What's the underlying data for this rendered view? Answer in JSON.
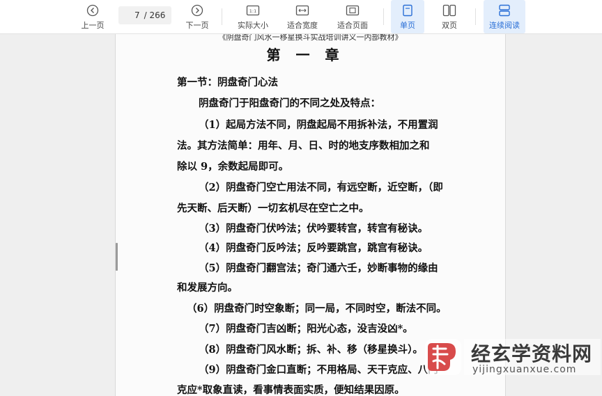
{
  "toolbar": {
    "prev_label": "上一页",
    "next_label": "下一页",
    "current_page": "7",
    "total_pages": "/ 266",
    "actual_size_label": "实际大小",
    "fit_width_label": "适合宽度",
    "fit_page_label": "适合页面",
    "single_page_label": "单页",
    "double_page_label": "双页",
    "continuous_label": "连续阅读",
    "accent_color": "#2a6fd6",
    "icons": [
      "chevron-left-icon",
      "chevron-right-icon",
      "actual-size-icon",
      "fit-width-icon",
      "fit-page-icon",
      "single-page-icon",
      "double-page-icon",
      "continuous-read-icon"
    ]
  },
  "document": {
    "header": "《阴盘奇门风水一移星换斗实战培训讲义一内部教材》",
    "chapter_title": "第一章",
    "lines": [
      "第一节：阴盘奇门心法",
      "阴盘奇门于阳盘奇门的不同之处及特点：",
      "（1）起局方法不同，阴盘起局不用拆补法，不用置润",
      "法。其方法简单：用年、月、日、时的地支序数相加之和",
      "除以 9，余数起局即可。",
      "（2）阴盘奇门空亡用法不同，有远空断，近空断，（即",
      "先天断、后天断）一切玄机尽在空亡之中。",
      "（3）阴盘奇门伏吟法；伏吟要转宫，转宫有秘诀。",
      "（4）阴盘奇门反吟法；反吟要跳宫，跳宫有秘诀。",
      "（5）阴盘奇门翻宫法；奇门通六壬，妙断事物的缘由",
      "和发展方向。",
      "（6）阴盘奇门时空象断；同一局，不同时空，断法不同。",
      "（7）阴盘奇门吉凶断；阳光心态，没吉没凶*。",
      "（8）阴盘奇门风水断；拆、补、移（移星换斗）。",
      "（9）阴盘奇门金口直断；不用格局、天干克应、八门",
      "克应*取象直读，看事情表面实质，便知结果因原。"
    ]
  },
  "watermark": {
    "site_name": "经玄学资料网",
    "domain": "yijingxuanxue.com",
    "logo_color": "#d84b4b"
  }
}
